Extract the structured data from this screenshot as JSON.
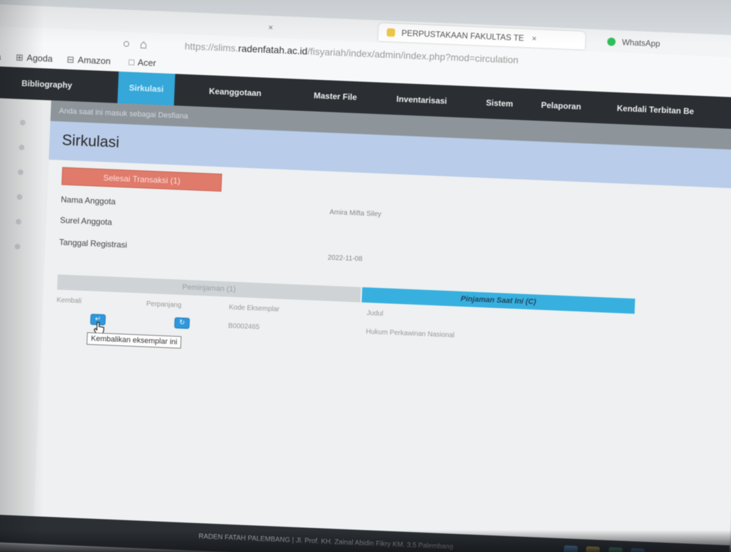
{
  "browser": {
    "tabs": [
      {
        "label": "",
        "close": "×"
      },
      {
        "label": "PERPUSTAKAAN FAKULTAS TE",
        "close": "×"
      },
      {
        "label": "WhatsApp",
        "close": ""
      }
    ],
    "url_prefix": "https://slims.",
    "url_domain": "radenfatah.ac.id",
    "url_path": "/fisyariah/index/admin/index.php?mod=circulation",
    "bookmarks": [
      "da",
      "Agoda",
      "Amazon",
      "Acer"
    ]
  },
  "nav": {
    "items": [
      "Bibliography",
      "Sirkulasi",
      "Keanggotaan",
      "Master File",
      "Inventarisasi",
      "Sistem",
      "Pelaporan",
      "Kendali Terbitan Be"
    ]
  },
  "banner": "Anda saat ini masuk sebagai Desfiana",
  "page": {
    "title": "Sirkulasi",
    "finish_button": "Selesai Transaksi (1)"
  },
  "member": {
    "name_label": "Nama Anggota",
    "name_value": "Amira Mifta Siley",
    "email_label": "Surel Anggota",
    "email_value": "",
    "reg_label": "Tanggal Registrasi",
    "reg_value": "2022-11-08"
  },
  "subtabs": {
    "loans_label": "Peminjaman (1)",
    "current_label": "Pinjaman Saat Ini (C)"
  },
  "table": {
    "headers": [
      "Kembali",
      "Perpanjang",
      "Kode Eksemplar",
      "Judul"
    ],
    "row": {
      "return_icon": "return-icon",
      "extend_icon": "extend-icon",
      "item_code": "B0002465",
      "title": "Hukum Perkawinan Nasional"
    }
  },
  "tooltip": "Kembalikan eksemplar ini",
  "footer": "RADEN FATAH PALEMBANG | Jl. Prof. KH. Zainal Abidin Fikry KM. 3,5 Palembang",
  "colors": {
    "nav_bg": "#2b2f34",
    "nav_active": "#35a7d8",
    "header_bg": "#b9cce9",
    "danger": "#e07a6a",
    "tab_active": "#37b0e0",
    "button_blue": "#2f98dc"
  }
}
